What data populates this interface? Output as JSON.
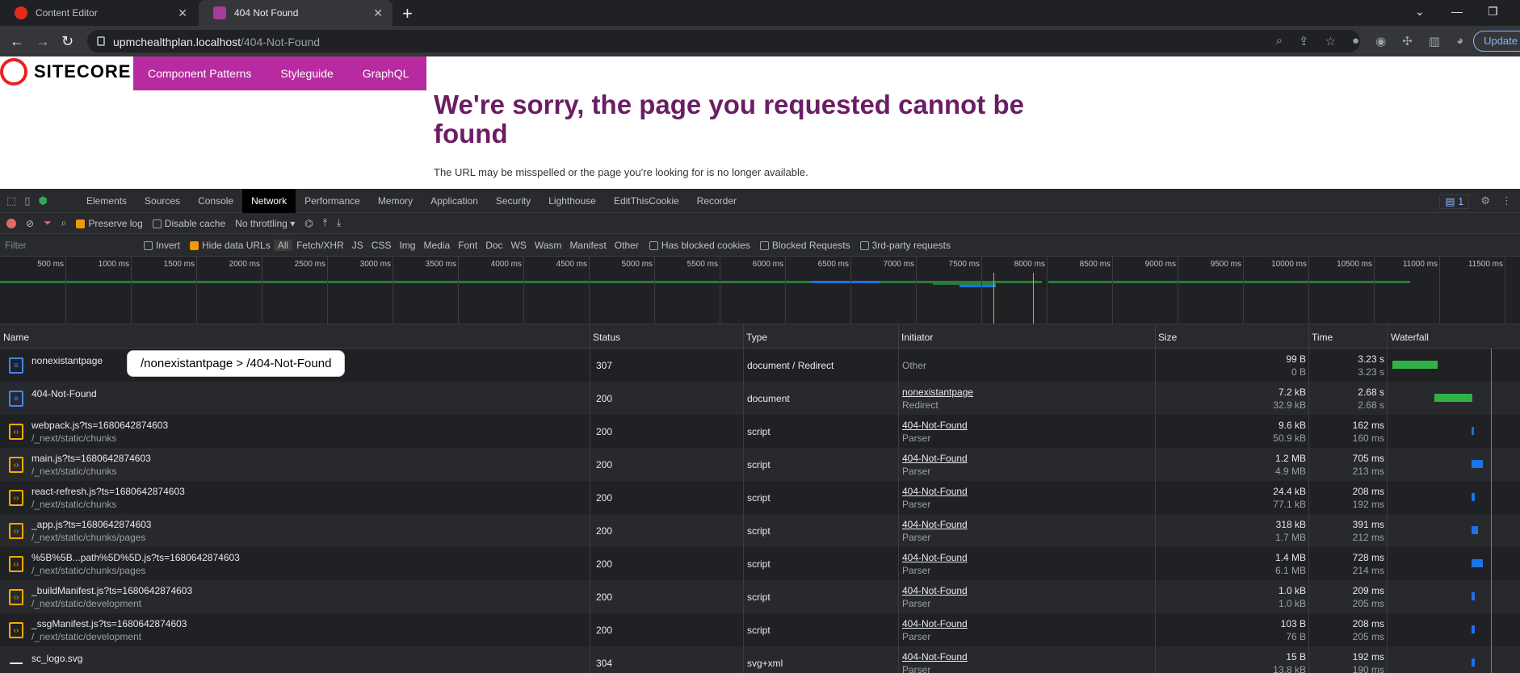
{
  "browser": {
    "tabs": [
      {
        "title": "Content Editor",
        "active": false
      },
      {
        "title": "404 Not Found",
        "active": true
      }
    ],
    "url_host": "upmchealthplan.localhost",
    "url_path": "/404-Not-Found",
    "update_label": "Update"
  },
  "page": {
    "logo_text": "SITECORE",
    "nav": [
      "Component Patterns",
      "Styleguide",
      "GraphQL"
    ],
    "title": "We're sorry, the page you requested cannot be found",
    "subtitle": "The URL may be misspelled or the page you're looking for is no longer available."
  },
  "devtools": {
    "tabs": [
      "Elements",
      "Sources",
      "Console",
      "Network",
      "Performance",
      "Memory",
      "Application",
      "Security",
      "Lighthouse",
      "EditThisCookie",
      "Recorder"
    ],
    "active_tab": "Network",
    "issues_count": "1",
    "toolbar": {
      "preserve_log": "Preserve log",
      "disable_cache": "Disable cache",
      "throttling": "No throttling"
    },
    "filter": {
      "placeholder": "Filter",
      "invert": "Invert",
      "hide_data_urls": "Hide data URLs",
      "types": [
        "All",
        "Fetch/XHR",
        "JS",
        "CSS",
        "Img",
        "Media",
        "Font",
        "Doc",
        "WS",
        "Wasm",
        "Manifest",
        "Other"
      ],
      "has_blocked_cookies": "Has blocked cookies",
      "blocked_requests": "Blocked Requests",
      "third_party": "3rd-party requests"
    },
    "overview_ticks": [
      "500 ms",
      "1000 ms",
      "1500 ms",
      "2000 ms",
      "2500 ms",
      "3000 ms",
      "3500 ms",
      "4000 ms",
      "4500 ms",
      "5000 ms",
      "5500 ms",
      "6000 ms",
      "6500 ms",
      "7000 ms",
      "7500 ms",
      "8000 ms",
      "8500 ms",
      "9000 ms",
      "9500 ms",
      "10000 ms",
      "10500 ms",
      "11000 ms",
      "11500 ms"
    ],
    "columns": [
      "Name",
      "Status",
      "Type",
      "Initiator",
      "Size",
      "Time",
      "Waterfall"
    ],
    "tooltip": "/nonexistantpage > /404-Not-Found",
    "rows": [
      {
        "icon": "doc",
        "name": "nonexistantpage",
        "path": "",
        "status": "307",
        "type": "document / Redirect",
        "initiator": "Other",
        "initiator_sub": "",
        "size": "99 B",
        "size_sub": "0 B",
        "time": "3.23 s",
        "time_sub": "3.23 s"
      },
      {
        "icon": "doc",
        "name": "404-Not-Found",
        "path": "",
        "status": "200",
        "type": "document",
        "initiator": "nonexistantpage",
        "initiator_sub": "Redirect",
        "size": "7.2 kB",
        "size_sub": "32.9 kB",
        "time": "2.68 s",
        "time_sub": "2.68 s"
      },
      {
        "icon": "script",
        "name": "webpack.js?ts=1680642874603",
        "path": "/_next/static/chunks",
        "status": "200",
        "type": "script",
        "initiator": "404-Not-Found",
        "initiator_sub": "Parser",
        "size": "9.6 kB",
        "size_sub": "50.9 kB",
        "time": "162 ms",
        "time_sub": "160 ms"
      },
      {
        "icon": "script",
        "name": "main.js?ts=1680642874603",
        "path": "/_next/static/chunks",
        "status": "200",
        "type": "script",
        "initiator": "404-Not-Found",
        "initiator_sub": "Parser",
        "size": "1.2 MB",
        "size_sub": "4.9 MB",
        "time": "705 ms",
        "time_sub": "213 ms"
      },
      {
        "icon": "script",
        "name": "react-refresh.js?ts=1680642874603",
        "path": "/_next/static/chunks",
        "status": "200",
        "type": "script",
        "initiator": "404-Not-Found",
        "initiator_sub": "Parser",
        "size": "24.4 kB",
        "size_sub": "77.1 kB",
        "time": "208 ms",
        "time_sub": "192 ms"
      },
      {
        "icon": "script",
        "name": "_app.js?ts=1680642874603",
        "path": "/_next/static/chunks/pages",
        "status": "200",
        "type": "script",
        "initiator": "404-Not-Found",
        "initiator_sub": "Parser",
        "size": "318 kB",
        "size_sub": "1.7 MB",
        "time": "391 ms",
        "time_sub": "212 ms"
      },
      {
        "icon": "script",
        "name": "%5B%5B...path%5D%5D.js?ts=1680642874603",
        "path": "/_next/static/chunks/pages",
        "status": "200",
        "type": "script",
        "initiator": "404-Not-Found",
        "initiator_sub": "Parser",
        "size": "1.4 MB",
        "size_sub": "6.1 MB",
        "time": "728 ms",
        "time_sub": "214 ms"
      },
      {
        "icon": "script",
        "name": "_buildManifest.js?ts=1680642874603",
        "path": "/_next/static/development",
        "status": "200",
        "type": "script",
        "initiator": "404-Not-Found",
        "initiator_sub": "Parser",
        "size": "1.0 kB",
        "size_sub": "1.0 kB",
        "time": "209 ms",
        "time_sub": "205 ms"
      },
      {
        "icon": "script",
        "name": "_ssgManifest.js?ts=1680642874603",
        "path": "/_next/static/development",
        "status": "200",
        "type": "script",
        "initiator": "404-Not-Found",
        "initiator_sub": "Parser",
        "size": "103 B",
        "size_sub": "76 B",
        "time": "208 ms",
        "time_sub": "205 ms"
      },
      {
        "icon": "img",
        "name": "sc_logo.svg",
        "path": "",
        "status": "304",
        "type": "svg+xml",
        "initiator": "404-Not-Found",
        "initiator_sub": "Parser",
        "size": "15 B",
        "size_sub": "13.8 kB",
        "time": "192 ms",
        "time_sub": "190 ms"
      }
    ]
  }
}
